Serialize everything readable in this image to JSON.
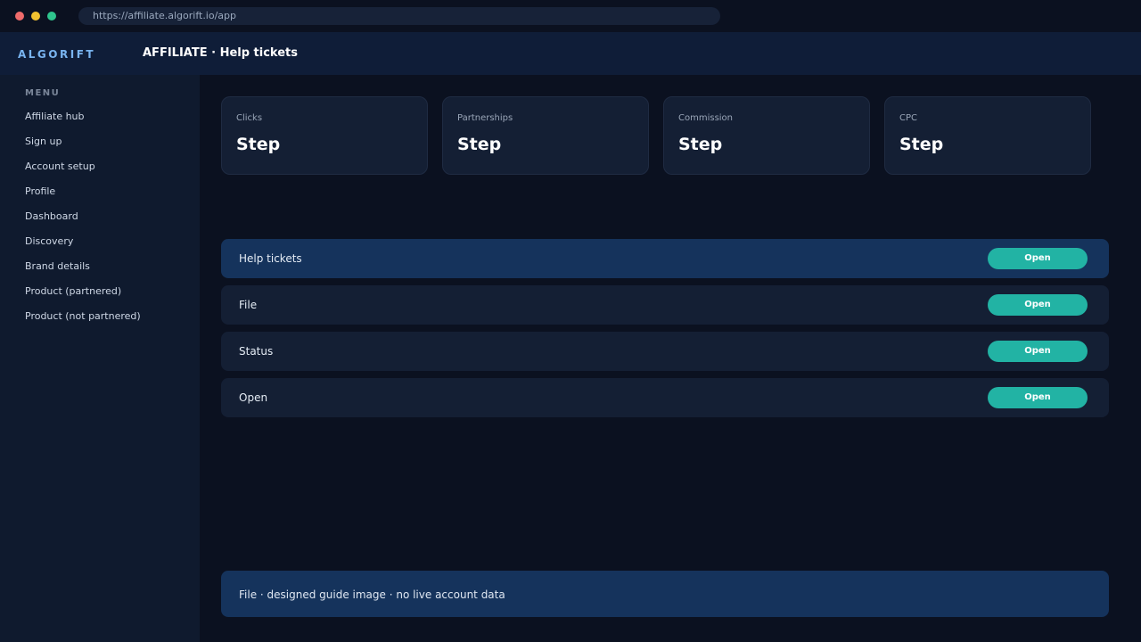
{
  "browser": {
    "url": "https://affiliate.algorift.io/app"
  },
  "header": {
    "brand": "ALGORIFT",
    "title": "AFFILIATE · Help tickets"
  },
  "sidebar": {
    "heading": "MENU",
    "items": [
      {
        "label": "Affiliate hub"
      },
      {
        "label": "Sign up"
      },
      {
        "label": "Account setup"
      },
      {
        "label": "Profile"
      },
      {
        "label": "Dashboard"
      },
      {
        "label": "Discovery"
      },
      {
        "label": "Brand details"
      },
      {
        "label": "Product (partnered)"
      },
      {
        "label": "Product (not partnered)"
      }
    ]
  },
  "stats": [
    {
      "label": "Clicks",
      "value": "Step"
    },
    {
      "label": "Partnerships",
      "value": "Step"
    },
    {
      "label": "Commission",
      "value": "Step"
    },
    {
      "label": "CPC",
      "value": "Step"
    }
  ],
  "rows": [
    {
      "label": "Help tickets",
      "action": "Open",
      "active": true
    },
    {
      "label": "File",
      "action": "Open",
      "active": false
    },
    {
      "label": "Status",
      "action": "Open",
      "active": false
    },
    {
      "label": "Open",
      "action": "Open",
      "active": false
    }
  ],
  "footer": {
    "note": "File · designed guide image · no live account data"
  },
  "colors": {
    "accent": "#22b3a4",
    "active_row": "#15335c",
    "brand": "#79b4f0"
  }
}
